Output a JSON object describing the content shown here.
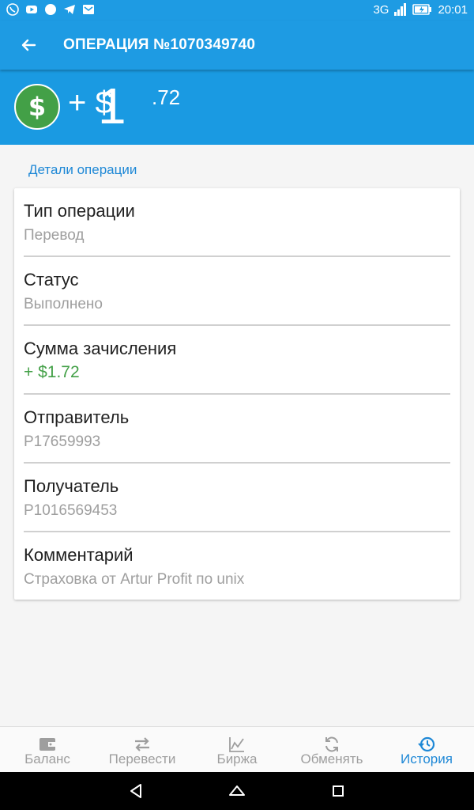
{
  "status_bar": {
    "network": "3G",
    "time": "20:01",
    "icons": [
      "viber-icon",
      "youtube-icon",
      "circle-icon",
      "telegram-icon",
      "mail-icon",
      "signal-icon",
      "battery-charging-icon"
    ]
  },
  "header": {
    "title": "ОПЕРАЦИЯ №1070349740",
    "back_icon": "arrow-back-icon"
  },
  "amount": {
    "icon": "dollar-coin-icon",
    "sign": "+ $",
    "integer": "1",
    "fraction": ".72",
    "coin_symbol": "$"
  },
  "details": {
    "section_title": "Детали операции",
    "rows": [
      {
        "label": "Тип операции",
        "value": "Перевод"
      },
      {
        "label": "Статус",
        "value": "Выполнено"
      },
      {
        "label": "Сумма зачисления",
        "value": "+ $1.72"
      },
      {
        "label": "Отправитель",
        "value": "P17659993"
      },
      {
        "label": "Получатель",
        "value": "P1016569453"
      },
      {
        "label": "Комментарий",
        "value": "Страховка от Artur Profit по unix"
      }
    ]
  },
  "bottom_nav": {
    "items": [
      {
        "label": "Баланс",
        "icon": "wallet-icon"
      },
      {
        "label": "Перевести",
        "icon": "transfer-icon"
      },
      {
        "label": "Биржа",
        "icon": "chart-icon"
      },
      {
        "label": "Обменять",
        "icon": "exchange-icon"
      },
      {
        "label": "История",
        "icon": "history-icon"
      }
    ],
    "active": "История"
  },
  "colors": {
    "primary": "#1e9be3",
    "accent_green": "#43a047",
    "active_nav": "#1e88d6"
  }
}
